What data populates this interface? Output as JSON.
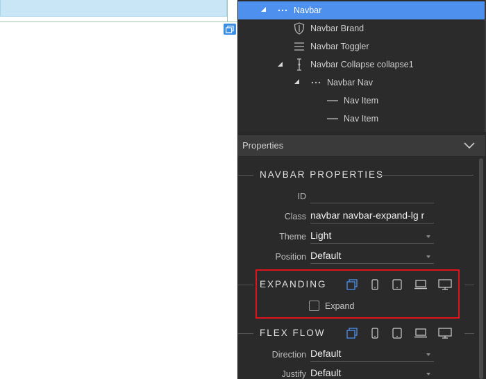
{
  "tree": {
    "items": [
      {
        "label": "Navbar",
        "icon": "dots-icon",
        "expanded": true,
        "selected": true
      },
      {
        "label": "Navbar Brand",
        "icon": "shield-icon"
      },
      {
        "label": "Navbar Toggler",
        "icon": "hamburger-icon"
      },
      {
        "label": "Navbar Collapse collapse1",
        "icon": "collapse-icon",
        "expanded": true
      },
      {
        "label": "Navbar Nav",
        "icon": "dots-icon",
        "expanded": true
      },
      {
        "label": "Nav Item",
        "icon": "dash-icon"
      },
      {
        "label": "Nav Item",
        "icon": "dash-icon"
      }
    ]
  },
  "properties": {
    "header": "Properties",
    "navbar_section": "NAVBAR PROPERTIES",
    "fields": {
      "id": {
        "label": "ID",
        "value": ""
      },
      "class": {
        "label": "Class",
        "value": "navbar navbar-expand-lg r"
      },
      "theme": {
        "label": "Theme",
        "value": "Light"
      },
      "position": {
        "label": "Position",
        "value": "Default"
      }
    },
    "expanding": {
      "title": "EXPANDING",
      "checkbox_label": "Expand",
      "checked": false
    },
    "flex_flow": {
      "title": "FLEX FLOW",
      "direction": {
        "label": "Direction",
        "value": "Default"
      },
      "justify": {
        "label": "Justify",
        "value": "Default"
      }
    },
    "breakpoint_icons": [
      "all-devices-icon",
      "phone-icon",
      "tablet-icon",
      "laptop-icon",
      "desktop-icon"
    ]
  },
  "colors": {
    "accent": "#4d90ee",
    "highlight_box": "#e0151b",
    "panel_bg": "#2a2a2a"
  }
}
